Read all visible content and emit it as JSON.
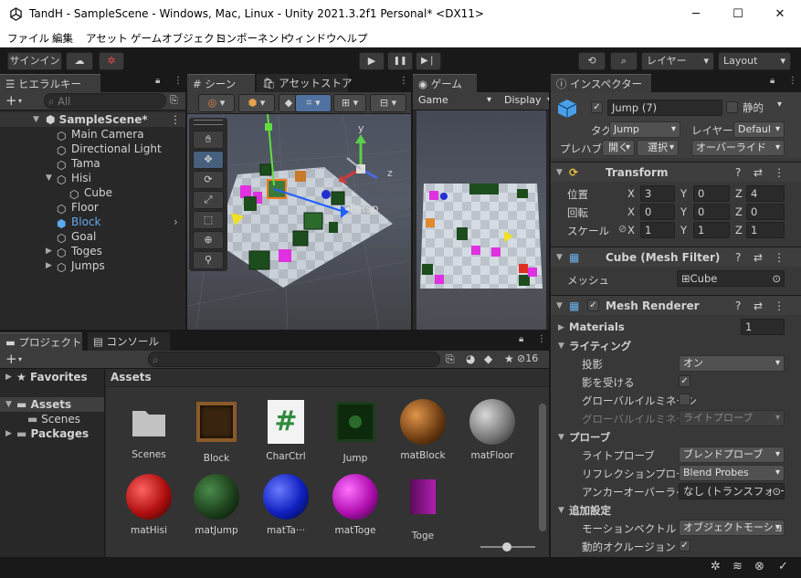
{
  "window": {
    "title": "TandH - SampleScene - Windows, Mac, Linux - Unity 2021.3.2f1 Personal* <DX11>",
    "minimize": "─",
    "maximize": "☐",
    "close": "✕"
  },
  "menu": [
    "ファイル",
    "編集",
    "アセット",
    "ゲームオブジェクト",
    "コンポーネント",
    "ウィンドウ",
    "ヘルプ"
  ],
  "toolbar": {
    "signin": "サインイン",
    "play": "▶",
    "pause": "❚❚",
    "step": "▶❘",
    "layers": "レイヤー",
    "layout": "Layout"
  },
  "hierarchy": {
    "tab": "ヒエラルキー",
    "search_placeholder": "All",
    "add": "+",
    "scene": "SampleScene*",
    "items": [
      "Main Camera",
      "Directional Light",
      "Tama",
      "Hisi",
      "Cube",
      "Floor",
      "Block",
      "Goal",
      "Toges",
      "Jumps"
    ]
  },
  "scene": {
    "tab": "シーン",
    "assetstore_tab": "アセットストア",
    "persp": "◂Persp",
    "axis_y": "y",
    "axis_z": "z"
  },
  "game": {
    "tab": "ゲーム",
    "view": "Game",
    "display": "Display"
  },
  "project": {
    "tab": "プロジェクト",
    "console_tab": "コンソール",
    "add": "+",
    "hidden_count": "16",
    "favorites": "Favorites",
    "assets": "Assets",
    "scenes": "Scenes",
    "packages": "Packages",
    "breadcrumb": "Assets",
    "items": [
      "Scenes",
      "Block",
      "CharCtrl",
      "Jump",
      "matBlock",
      "matFloor",
      "matHisi",
      "matJump",
      "matTa···",
      "matToge",
      "Toge"
    ],
    "script_glyph": "#"
  },
  "inspector": {
    "tab": "インスペクター",
    "name": "Jump (7)",
    "static": "静的",
    "tag_label": "タグ",
    "tag": "Jump",
    "layer_label": "レイヤー",
    "layer": "Defaul",
    "prefab_label": "プレハブ",
    "open": "開く",
    "select": "選択",
    "overrides": "オーバーライド",
    "transform": {
      "title": "Transform",
      "position_label": "位置",
      "rotation_label": "回転",
      "scale_label": "スケール",
      "x": "X",
      "y": "Y",
      "z": "Z",
      "position": [
        "3",
        "0",
        "4"
      ],
      "rotation": [
        "0",
        "0",
        "0"
      ],
      "scale": [
        "1",
        "1",
        "1"
      ]
    },
    "meshfilter": {
      "title": "Cube (Mesh Filter)",
      "mesh_label": "メッシュ",
      "mesh": "Cube"
    },
    "meshrenderer": {
      "title": "Mesh Renderer",
      "materials_label": "Materials",
      "materials_count": "1",
      "lighting": "ライティング",
      "cast_label": "投影",
      "cast": "オン",
      "receive_label": "影を受ける",
      "gi_label": "グローバルイルミネーシ",
      "gi2_label": "グローバルイルミネーシ",
      "gi2": "ライトプローブ",
      "probes": "プローブ",
      "lightprobe_label": "ライトプローブ",
      "lightprobe": "ブレンドプローブ",
      "reflection_label": "リフレクションプローブ",
      "reflection": "Blend Probes",
      "anchor_label": "アンカーオーバーライド",
      "anchor": "なし (トランスフォーム",
      "additional": "追加設定",
      "motion_label": "モーションベクトル",
      "motion": "オブジェクトモーション",
      "occlusion_label": "動的オクルージョン"
    }
  },
  "colors": {
    "selection": "#2c5d87",
    "accent": "#4fa3e0"
  }
}
